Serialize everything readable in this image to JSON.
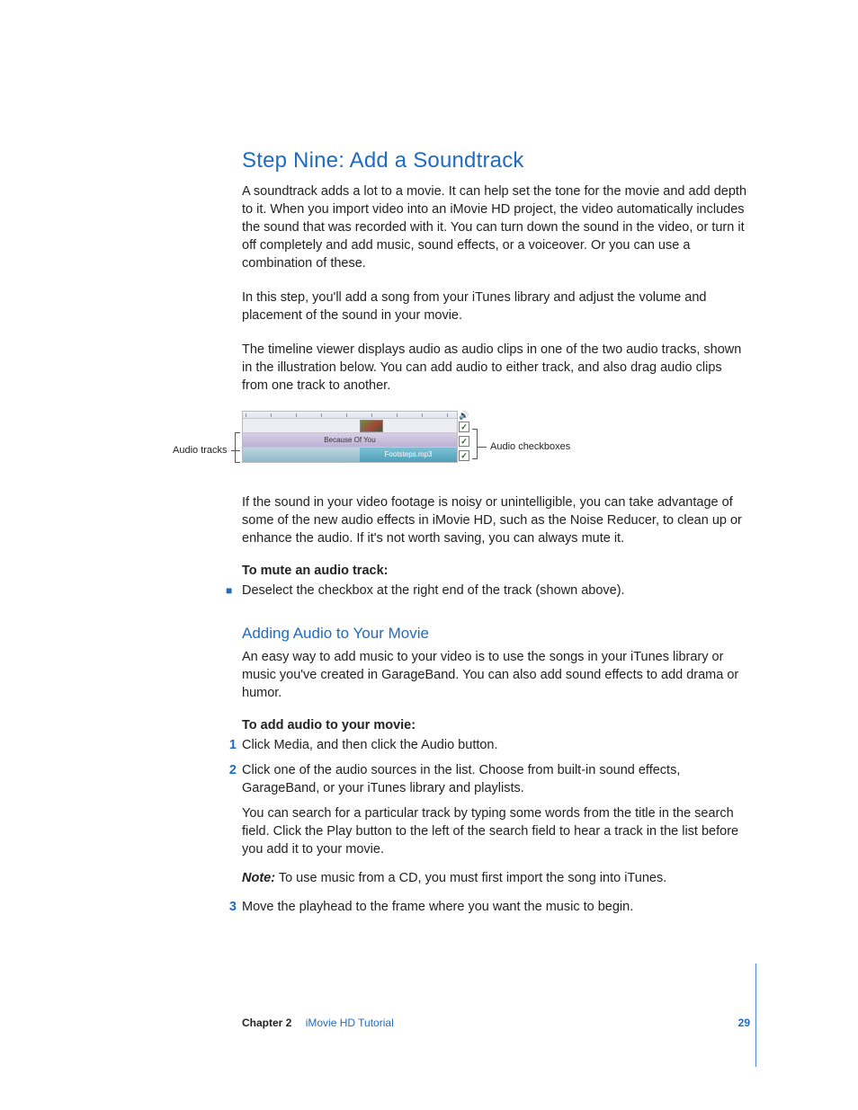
{
  "heading": "Step Nine: Add a Soundtrack",
  "p1": "A soundtrack adds a lot to a movie. It can help set the tone for the movie and add depth to it. When you import video into an iMovie HD project, the video automatically includes the sound that was recorded with it. You can turn down the sound in the video, or turn it off completely and add music, sound effects, or a voiceover. Or you can use a combination of these.",
  "p2": "In this step, you'll add a song from your iTunes library and adjust the volume and placement of the sound in your movie.",
  "p3": "The timeline viewer displays audio as audio clips in one of the two audio tracks, shown in the illustration below. You can add audio to either track, and also drag audio clips from one track to another.",
  "illus": {
    "left_label": "Audio tracks",
    "right_label": "Audio checkboxes",
    "track1_clip": "Because Of You",
    "track2_clip": "Footsteps.mp3"
  },
  "p4": "If the sound in your video footage is noisy or unintelligible, you can take advantage of some of the new audio effects in iMovie HD, such as the Noise Reducer, to clean up or enhance the audio. If it's not worth saving, you can always mute it.",
  "mute_heading": "To mute an audio track:",
  "mute_bullet": "Deselect the checkbox at the right end of the track (shown above).",
  "sub_heading": "Adding Audio to Your Movie",
  "p5": "An easy way to add music to your video is to use the songs in your iTunes library or music you've created in GarageBand. You can also add sound effects to add drama or humor.",
  "add_heading": "To add audio to your movie:",
  "steps": [
    "Click Media, and then click the Audio button.",
    "Click one of the audio sources in the list. Choose from built-in sound effects, GarageBand, or your iTunes library and playlists.",
    "Move the playhead to the frame where you want the music to begin."
  ],
  "step2_extra": "You can search for a particular track by typing some words from the title in the search field. Click the Play button to the left of the search field to hear a track in the list before you add it to your movie.",
  "note_label": "Note:",
  "note_text": "  To use music from a CD, you must first import the song into iTunes.",
  "footer": {
    "chapter": "Chapter 2",
    "title": "iMovie HD Tutorial",
    "page": "29"
  }
}
